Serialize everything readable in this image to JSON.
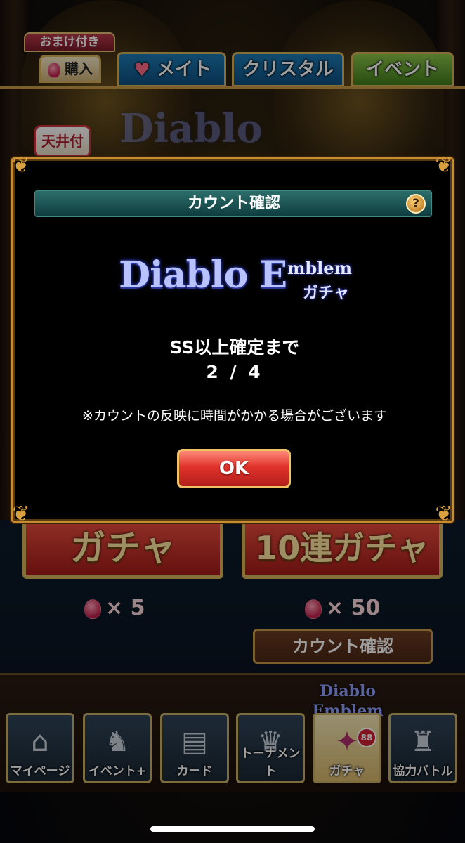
{
  "tabs": {
    "omake": "おまけ付き",
    "purchase": "購入",
    "mate": "メイト",
    "crystal": "クリスタル",
    "event": "イベント"
  },
  "background": {
    "ceiling_badge": "天井付き",
    "gacha_single": "ガチャ",
    "gacha_ten": "10連ガチャ",
    "cost_single": "× 5",
    "cost_ten": "× 50",
    "count_confirm": "カウント確認"
  },
  "dialog": {
    "title": "カウント確認",
    "help": "?",
    "logo_main": "Diablo E",
    "logo_emblem": "mblem",
    "logo_gacha": "ガチャ",
    "line1": "SS以上確定まで",
    "line2": "2 / 4",
    "note": "※カウントの反映に時間がかかる場合がございます",
    "ok": "OK"
  },
  "nav": {
    "logo": "Diablo Emblem",
    "badge": "88",
    "items": [
      {
        "label": "マイページ",
        "icon": "house-icon"
      },
      {
        "label": "イベント+",
        "icon": "cat-icon"
      },
      {
        "label": "カード",
        "icon": "cards-icon"
      },
      {
        "label": "トーナメント",
        "icon": "trophy-icon"
      },
      {
        "label": "ガチャ",
        "icon": "gacha-icon"
      },
      {
        "label": "協力バトル",
        "icon": "castle-icon"
      }
    ]
  },
  "colors": {
    "dialog_border": "#c78b32",
    "header_teal": "#2b6e6a",
    "ok_red": "#e0332b"
  }
}
